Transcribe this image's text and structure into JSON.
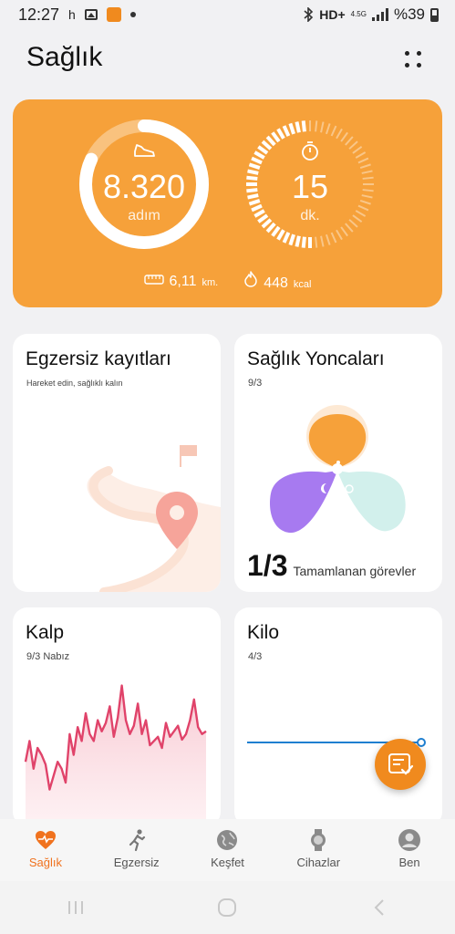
{
  "status_bar": {
    "time": "12:27",
    "h_indicator": "h",
    "network_type": "HD+",
    "network_gen": "4.5G",
    "battery": "%39"
  },
  "header": {
    "title": "Sağlık"
  },
  "activity": {
    "steps_value": "8.320",
    "steps_unit": "adım",
    "steps_progress": 0.82,
    "minutes_value": "15",
    "minutes_unit": "dk.",
    "minutes_progress": 0.5,
    "distance_value": "6,11",
    "distance_unit": "km.",
    "calories_value": "448",
    "calories_unit": "kcal"
  },
  "cards": {
    "exercise": {
      "title": "Egzersiz kayıtları",
      "subtitle": "Hareket edin, sağlıklı kalın"
    },
    "clovers": {
      "title": "Sağlık Yoncaları",
      "date": "9/3",
      "completed": "1/3",
      "completed_label": "Tamamlanan görevler"
    },
    "heart": {
      "title": "Kalp",
      "subtitle": "9/3 Nabız",
      "series": [
        40,
        55,
        35,
        50,
        45,
        38,
        20,
        30,
        40,
        35,
        25,
        60,
        45,
        65,
        55,
        75,
        60,
        55,
        70,
        62,
        68,
        80,
        58,
        72,
        95,
        70,
        60,
        66,
        82,
        60,
        70,
        52,
        55,
        58,
        50,
        68,
        58,
        62,
        66,
        56,
        60,
        70,
        85,
        65,
        60,
        62
      ]
    },
    "weight": {
      "title": "Kilo",
      "subtitle": "4/3"
    }
  },
  "tabs": [
    {
      "label": "Sağlık",
      "icon": "heart-pulse-icon",
      "active": true
    },
    {
      "label": "Egzersiz",
      "icon": "running-icon",
      "active": false
    },
    {
      "label": "Keşfet",
      "icon": "globe-icon",
      "active": false
    },
    {
      "label": "Cihazlar",
      "icon": "watch-icon",
      "active": false
    },
    {
      "label": "Ben",
      "icon": "person-icon",
      "active": false
    }
  ],
  "colors": {
    "accent": "#f0721e",
    "activity_bg": "#f6a13a",
    "heart_line": "#e0436a",
    "weight_line": "#1f7fd0"
  }
}
